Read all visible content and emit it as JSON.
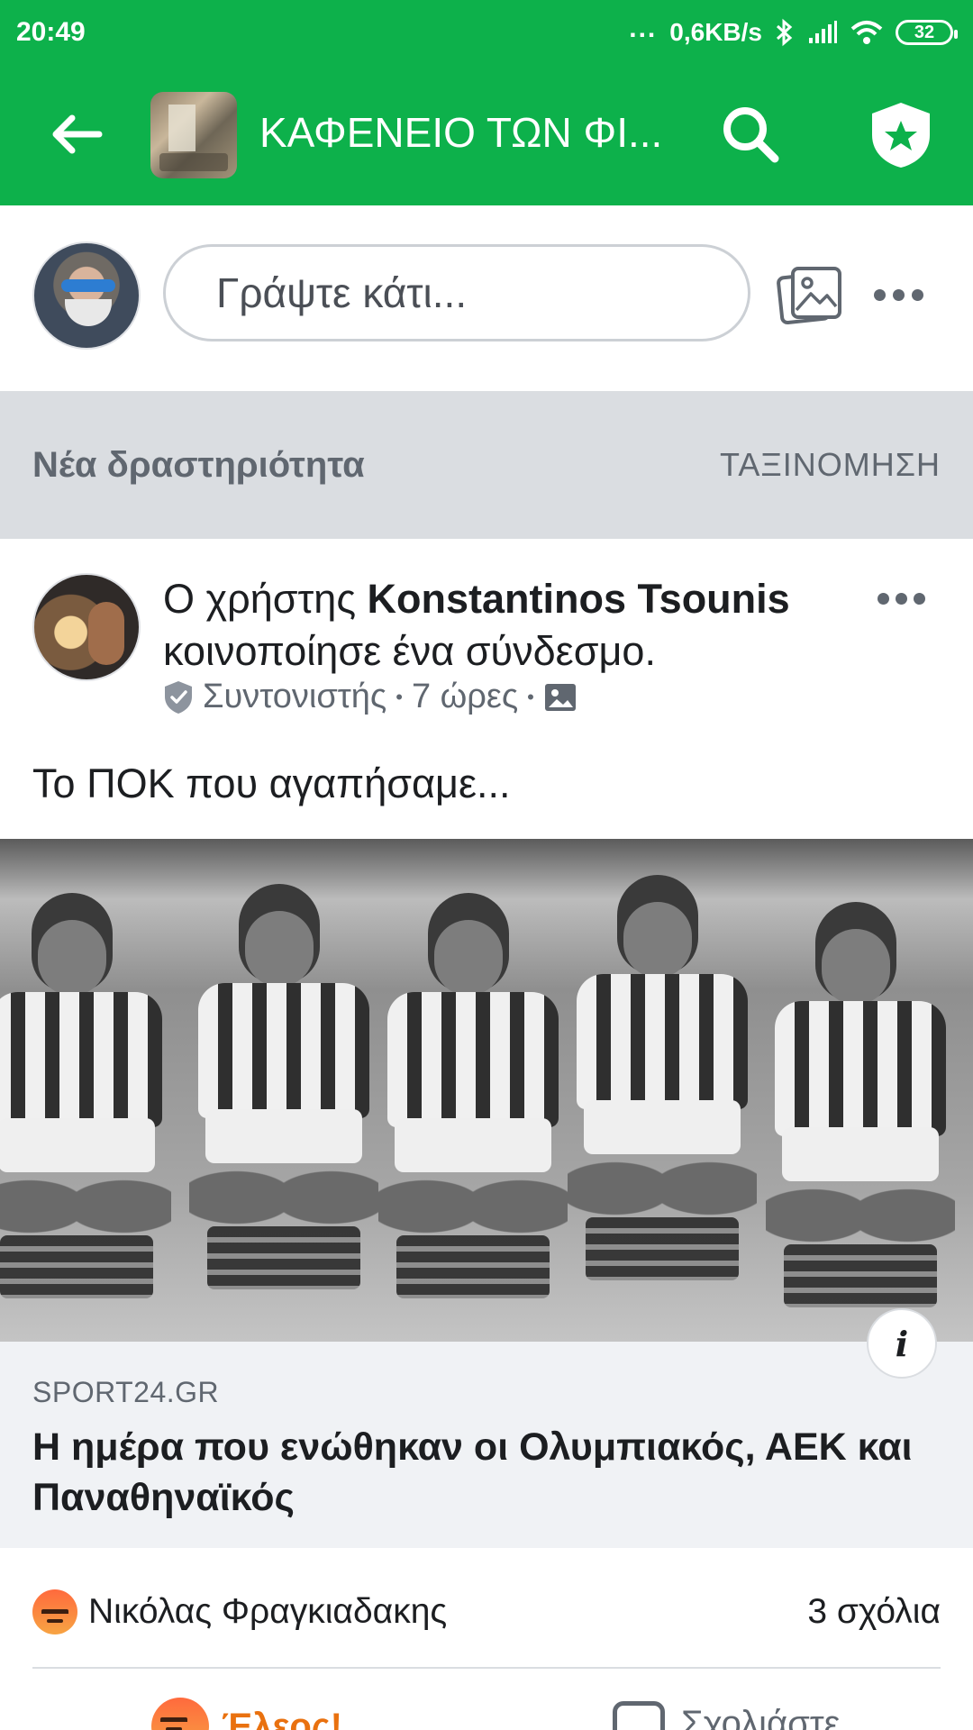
{
  "status_bar": {
    "time": "20:49",
    "dots": "...",
    "net_speed": "0,6KB/s",
    "battery": "32",
    "icons": [
      "bluetooth-icon",
      "signal-icon",
      "wifi-icon",
      "battery-icon"
    ]
  },
  "app_bar": {
    "title": "ΚΑΦΕΝΕΙΟ ΤΩΝ ΦΙ...",
    "icons": [
      "back-arrow-icon",
      "search-icon",
      "admin-badge-icon"
    ],
    "color": "#0db14b"
  },
  "composer": {
    "placeholder": "Γράψτε κάτι..."
  },
  "feed_header": {
    "title": "Νέα δραστηριότητα",
    "sort": "ΤΑΞΙΝΟΜΗΣΗ"
  },
  "post": {
    "prefix": "Ο χρήστης ",
    "author": "Konstantinos Tsounis",
    "action": "κοινοποίησε ένα σύνδεσμο.",
    "role": "Συντονιστής",
    "sep": "•",
    "time": "7 ώρες",
    "text": "Το ΠΟΚ που αγαπήσαμε...",
    "link": {
      "domain": "SPORT24.GR",
      "title": "Η ημέρα που ενώθηκαν οι Ολυμπιακός, ΑΕΚ και Παναθηναϊκός"
    },
    "info_glyph": "i",
    "reactor": "Νικόλας Φραγκιαδακης",
    "comments": "3 σχόλια",
    "actions": {
      "reaction_label": "Έλεος!",
      "comment_label": "Σχολιάστε"
    }
  }
}
